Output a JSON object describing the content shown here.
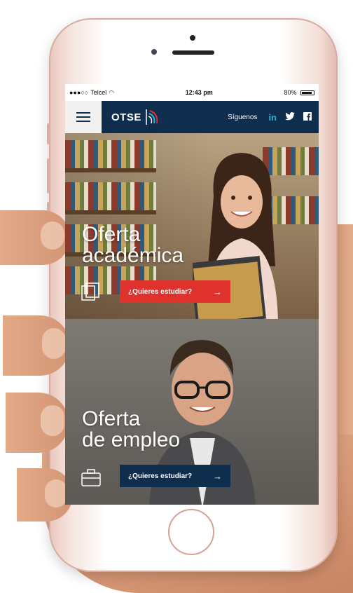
{
  "status_bar": {
    "carrier": "Telcel",
    "time": "12:43 pm",
    "battery": "80%"
  },
  "navbar": {
    "menu_icon": "hamburger-icon",
    "logo_text": "OTSE",
    "follow_label": "Síguenos",
    "social": [
      {
        "name": "linkedin",
        "glyph": "in"
      },
      {
        "name": "twitter",
        "glyph": "🐦"
      },
      {
        "name": "facebook",
        "glyph": "f"
      }
    ]
  },
  "panels": [
    {
      "title_line1": "Oferta",
      "title_line2": "académica",
      "icon": "books-icon",
      "cta_label": "¿Quieres estudiar?",
      "cta_arrow": "→",
      "cta_color": "#e0322d"
    },
    {
      "title_line1": "Oferta",
      "title_line2": "de empleo",
      "icon": "briefcase-icon",
      "cta_label": "¿Quieres estudiar?",
      "cta_arrow": "→",
      "cta_color": "#0f2d4d"
    }
  ],
  "colors": {
    "navy": "#0f2d4d",
    "accent_red": "#e0322d",
    "social_blue": "#2ab2d4"
  }
}
